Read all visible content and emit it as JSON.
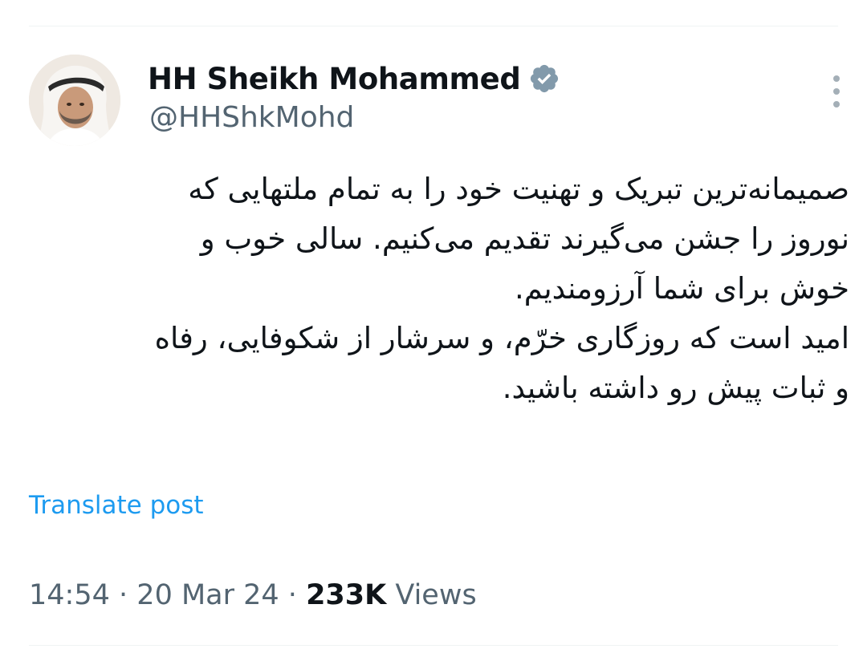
{
  "author": {
    "display_name": "HH Sheikh Mohammed",
    "handle": "@HHShkMohd",
    "verified_icon": "verified-badge-icon",
    "avatar_icon": "profile-photo"
  },
  "menu": {
    "icon": "more-vertical-icon"
  },
  "post": {
    "lines": [
      "صمیمانه‌ترین تبریک و تهنیت خود را به تمام ملتهایی که",
      "نوروز را جشن می‌گیرند تقدیم می‌کنیم. سالی خوب و",
      "خوش برای شما آرزومندیم.",
      "امید است که روزگاری خرّم، و سرشار از شکوفایی، رفاه",
      "و ثبات پیش رو داشته باشید."
    ],
    "translate_label": "Translate post"
  },
  "meta": {
    "time": "14:54",
    "separator": "·",
    "date": "20 Mar 24",
    "views_count": "233K",
    "views_label": "Views"
  },
  "colors": {
    "text": "#0f1419",
    "secondary": "#536471",
    "link": "#1d9bf0",
    "badge": "#829aab",
    "divider": "#eff3f4"
  }
}
